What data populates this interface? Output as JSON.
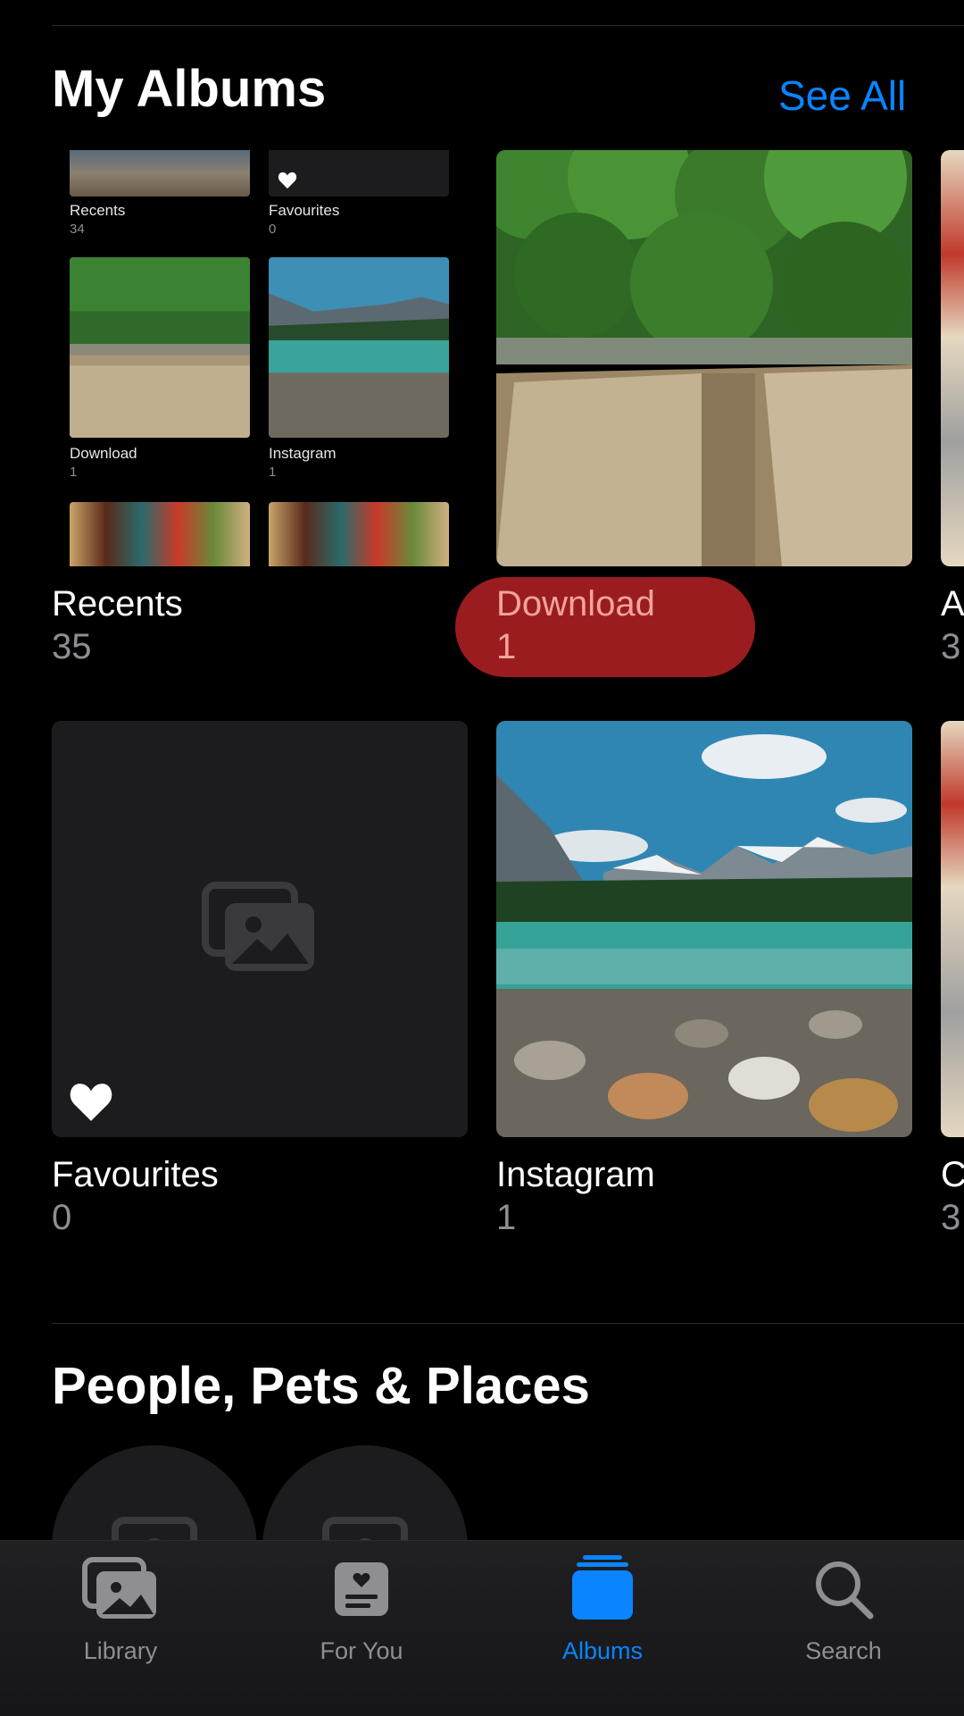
{
  "my_albums": {
    "title": "My Albums",
    "see_all": "See All",
    "albums": [
      {
        "name": "Recents",
        "count": "35"
      },
      {
        "name": "Download",
        "count": "1"
      },
      {
        "name": "A",
        "count": "3"
      },
      {
        "name": "Favourites",
        "count": "0"
      },
      {
        "name": "Instagram",
        "count": "1"
      },
      {
        "name": "C",
        "count": "3"
      }
    ],
    "recents_preview": [
      {
        "name": "Recents",
        "count": "34"
      },
      {
        "name": "Favourites",
        "count": "0"
      },
      {
        "name": "Download",
        "count": "1"
      },
      {
        "name": "Instagram",
        "count": "1"
      }
    ]
  },
  "people": {
    "title": "People, Pets & Places"
  },
  "tabbar": {
    "tabs": [
      {
        "label": "Library",
        "icon": "photos-stack-icon",
        "active": false
      },
      {
        "label": "For You",
        "icon": "for-you-icon",
        "active": false
      },
      {
        "label": "Albums",
        "icon": "albums-icon",
        "active": true
      },
      {
        "label": "Search",
        "icon": "search-icon",
        "active": false
      }
    ]
  },
  "colors": {
    "accent": "#0a84ff",
    "highlight": "#9b1c1f",
    "background": "#000000"
  }
}
